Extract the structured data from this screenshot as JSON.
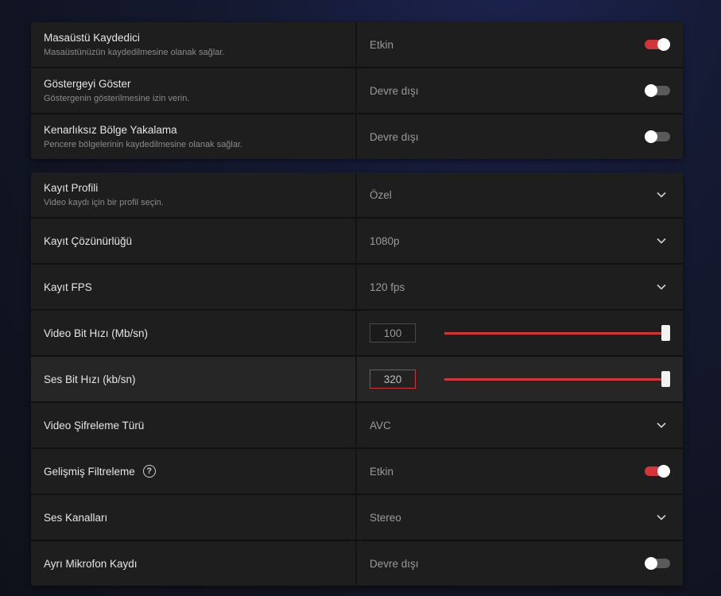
{
  "colors": {
    "accent": "#d4343a",
    "row_bg": "#1e1e1e",
    "row_highlight_bg": "#262626",
    "toggle_off": "#5a5a5a"
  },
  "panel1": {
    "rows": [
      {
        "title": "Masaüstü Kaydedici",
        "description": "Masaüstünüzün kaydedilmesine olanak sağlar.",
        "value": "Etkin",
        "control": "toggle",
        "checked": true
      },
      {
        "title": "Göstergeyi Göster",
        "description": "Göstergenin gösterilmesine izin verin.",
        "value": "Devre dışı",
        "control": "toggle",
        "checked": false
      },
      {
        "title": "Kenarlıksız Bölge Yakalama",
        "description": "Pencere bölgelerinin kaydedilmesine olanak sağlar.",
        "value": "Devre dışı",
        "control": "toggle",
        "checked": false
      }
    ]
  },
  "panel2": {
    "rows": [
      {
        "title": "Kayıt Profili",
        "description": "Video kaydı için bir profil seçin.",
        "value": "Özel",
        "control": "dropdown",
        "icon": "chevron-down-icon"
      },
      {
        "title": "Kayıt Çözünürlüğü",
        "value": "1080p",
        "control": "dropdown",
        "icon": "chevron-down-icon"
      },
      {
        "title": "Kayıt FPS",
        "value": "120 fps",
        "control": "dropdown",
        "icon": "chevron-down-icon"
      },
      {
        "title": "Video Bit Hızı (Mb/sn)",
        "value": "100",
        "control": "slider",
        "slider_fraction": 1.0
      },
      {
        "title": "Ses Bit Hızı (kb/sn)",
        "value": "320",
        "control": "slider",
        "slider_fraction": 1.0
      },
      {
        "title": "Video Şifreleme Türü",
        "value": "AVC",
        "control": "dropdown",
        "icon": "chevron-down-icon"
      },
      {
        "title": "Gelişmiş Filtreleme",
        "help_icon": "question-circle-icon",
        "help_glyph": "?",
        "value": "Etkin",
        "control": "toggle",
        "checked": true
      },
      {
        "title": "Ses Kanalları",
        "value": "Stereo",
        "control": "dropdown",
        "icon": "chevron-down-icon"
      },
      {
        "title": "Ayrı Mikrofon Kaydı",
        "value": "Devre dışı",
        "control": "toggle",
        "checked": false
      }
    ]
  }
}
